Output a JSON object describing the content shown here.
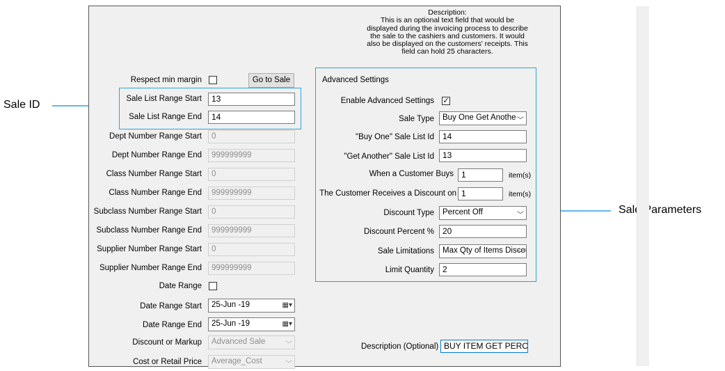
{
  "callouts": {
    "sale_id": "Sale ID",
    "sale_parameters": "Sale Parameters"
  },
  "colors": {
    "accent": "#2aa3e0",
    "panel_bg": "#f0f0f0"
  },
  "description_help": [
    "Description:",
    "This is an optional text field that would be",
    "displayed during the invoicing process to describe",
    "the sale to the cashiers and customers. It would",
    "also be displayed on the customers' receipts. This",
    "field can hold 25 characters."
  ],
  "left": {
    "respect_min_margin_label": "Respect min margin",
    "go_to_sale": "Go to Sale",
    "sale_list_range_start_label": "Sale List Range Start",
    "sale_list_range_start": "13",
    "sale_list_range_end_label": "Sale List Range End",
    "sale_list_range_end": "14",
    "dept_start_label": "Dept Number Range Start",
    "dept_start": "0",
    "dept_end_label": "Dept Number Range End",
    "dept_end": "999999999",
    "class_start_label": "Class Number Range Start",
    "class_start": "0",
    "class_end_label": "Class Number Range End",
    "class_end": "999999999",
    "subclass_start_label": "Subclass Number Range Start",
    "subclass_start": "0",
    "subclass_end_label": "Subclass Number Range End",
    "subclass_end": "999999999",
    "supplier_start_label": "Supplier Number Range Start",
    "supplier_start": "0",
    "supplier_end_label": "Supplier Number Range End",
    "supplier_end": "999999999",
    "date_range_label": "Date Range",
    "date_start_label": "Date Range Start",
    "date_start": "25-Jun -19",
    "date_end_label": "Date Range End",
    "date_end": "25-Jun -19",
    "discount_or_markup_label": "Discount or Markup",
    "discount_or_markup": "Advanced Sale",
    "cost_or_retail_label": "Cost or Retail Price",
    "cost_or_retail": "Average_Cost"
  },
  "advanced": {
    "group_title": "Advanced Settings",
    "enable_label": "Enable Advanced Settings",
    "sale_type_label": "Sale Type",
    "sale_type": "Buy One Get Anothe",
    "buy_one_label": "\"Buy One\" Sale List Id",
    "buy_one": "14",
    "get_another_label": "\"Get Another\" Sale List Id",
    "get_another": "13",
    "when_buys_label": "When a Customer Buys",
    "when_buys": "1",
    "items_unit": "item(s)",
    "receives_label": "The Customer Receives a Discount on",
    "receives": "1",
    "discount_type_label": "Discount Type",
    "discount_type": "Percent Off",
    "discount_percent_label": "Discount Percent %",
    "discount_percent": "20",
    "sale_limitations_label": "Sale Limitations",
    "sale_limitations": "Max Qty of Items Discounted",
    "limit_quantity_label": "Limit Quantity",
    "limit_quantity": "2"
  },
  "description_label": "Description (Optional)",
  "description_value": "BUY ITEM GET PERCE"
}
